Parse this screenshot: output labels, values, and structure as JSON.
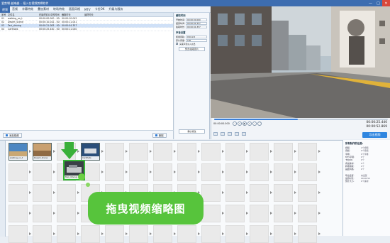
{
  "window": {
    "title": "爱剪辑  越来越...  插入在视频剪辑软件",
    "controls": [
      "—",
      "□",
      "✕"
    ]
  },
  "menu": [
    "视频",
    "音频",
    "字幕特效",
    "叠加素材",
    "转场特效",
    "画面风格",
    "MTV",
    "卡拉OK",
    "升级与服务"
  ],
  "file_table": {
    "headers": [
      "序号",
      "文件名",
      "在最终影片中的时间",
      "截取时长",
      "最终时长"
    ],
    "rows": [
      [
        "01",
        "walking_on_t",
        "00:00:00.000 - 00:00:10.042",
        "00:00:10.042",
        ""
      ],
      [
        "02",
        "Desert_Scene",
        "00:00:10.042 - 00:00:21.083",
        "00:00:11.041",
        ""
      ],
      [
        "03",
        "Taxi_driving",
        "00:00:21.083 - 00:00:25.440",
        "00:00:04.357",
        ""
      ],
      [
        "04",
        "CarShots",
        "00:00:25.440 - 00:00:36.480",
        "00:00:11.040",
        ""
      ]
    ],
    "selected_row": 2,
    "add_button": "添加视频",
    "delete_button": "删除"
  },
  "props": {
    "section_time": "截取时间",
    "fields": [
      {
        "label": "开始时间:",
        "value": "00:00:00.000"
      },
      {
        "label": "结束时间:",
        "value": "00:00:04.357"
      },
      {
        "label": "截取时长:",
        "value": "00:00:04.357"
      }
    ],
    "section_audio": "声音设置",
    "audio_fields": [
      {
        "label": "使用音轨:",
        "value": "原片声音"
      },
      {
        "label": "原片音量:",
        "value": "100"
      }
    ],
    "checkbox_label": "头尾声音淡入淡出",
    "btn_preview": "预览/截取原片",
    "btn_confirm": "确认修改"
  },
  "player": {
    "time_current": "00:00:25.440",
    "time_total": "00:00:52.869",
    "progress": 0.48,
    "clip_time": "00:00:00.000",
    "export_button": "导出视频"
  },
  "timeline": {
    "clips": [
      {
        "label": "walking_on_t",
        "col": 0,
        "row": 0
      },
      {
        "label": "Desert_Scene",
        "col": 1,
        "row": 0
      },
      {
        "label": "CarShots",
        "col": 3,
        "row": 0
      }
    ],
    "dragged_label": "Taxi_driving"
  },
  "callout": "拖曳视频缩略图",
  "info_panel": {
    "title": "所有制作的信息:",
    "rows": [
      {
        "k": "视频:",
        "v": "4个视频"
      },
      {
        "k": "音频:",
        "v": "0个音频"
      },
      {
        "k": "字幕:",
        "v": "0个字幕"
      },
      {
        "k": "MTV字幕:",
        "v": "0个"
      },
      {
        "k": "卡拉OK:",
        "v": "0个"
      },
      {
        "k": "叠加素材:",
        "v": "0个"
      },
      {
        "k": "转场特效:",
        "v": "0个"
      },
      {
        "k": "画面风格:",
        "v": "0个"
      },
      {
        "k": "",
        "v": ""
      },
      {
        "k": "导出设置:",
        "v": "未设置"
      },
      {
        "k": "最终时长:",
        "v": "00:00:52"
      },
      {
        "k": "预计大小:",
        "v": "0个素材"
      }
    ]
  }
}
